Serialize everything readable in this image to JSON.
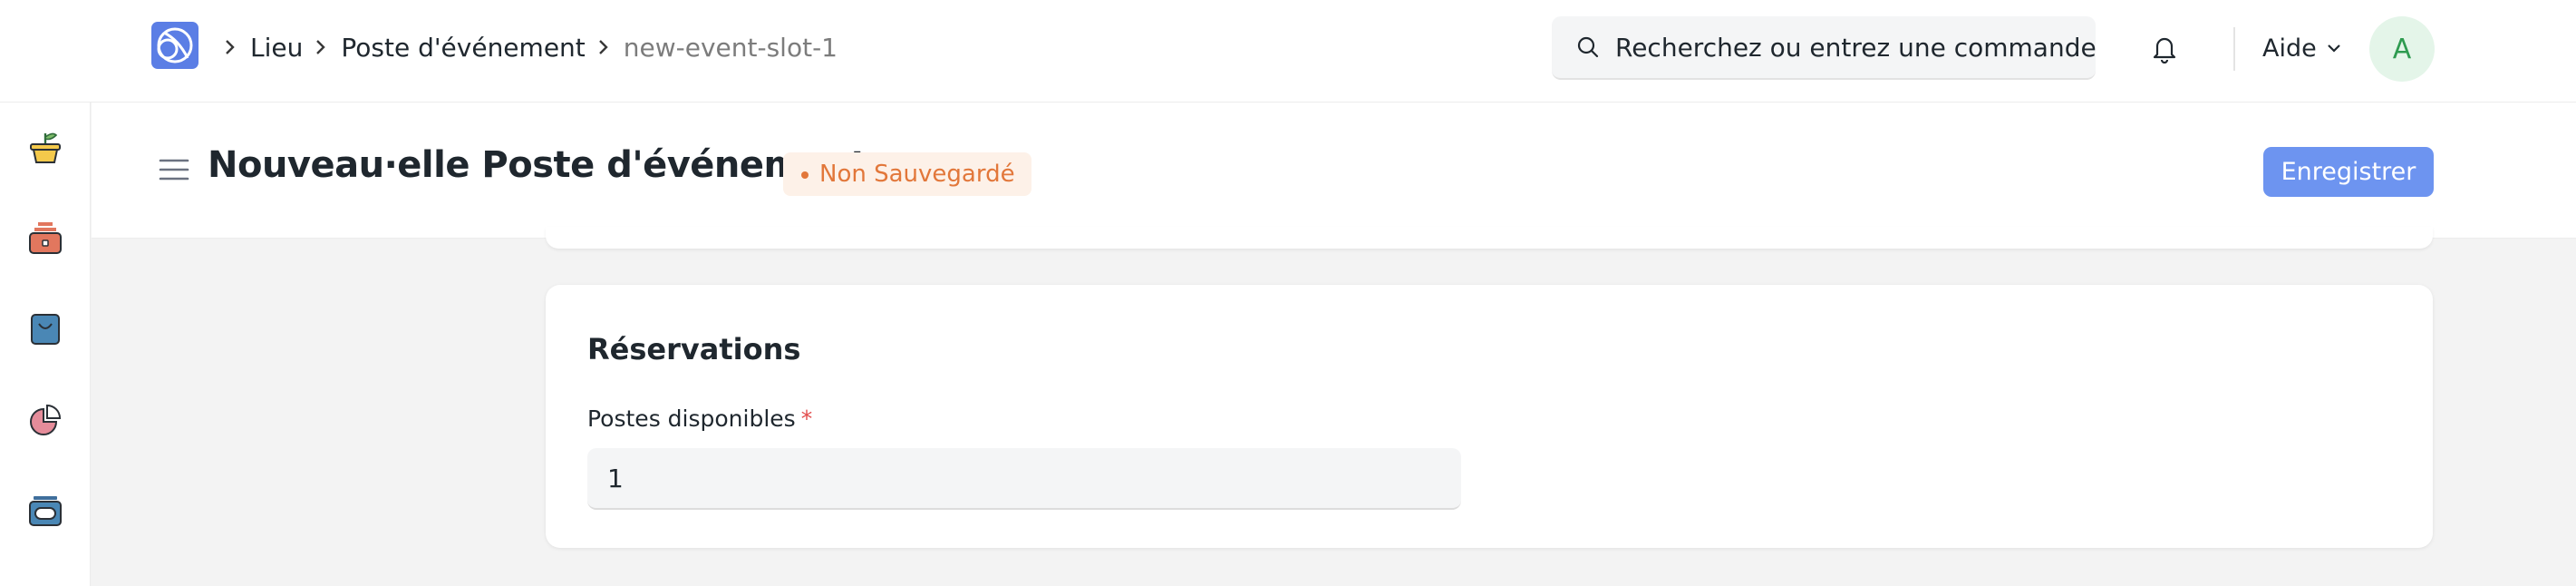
{
  "breadcrumb": {
    "items": [
      "Lieu",
      "Poste d'événement"
    ],
    "current": "new-event-slot-1"
  },
  "search": {
    "placeholder": "Recherchez ou entrez une commande"
  },
  "navbar": {
    "help_label": "Aide",
    "avatar_initial": "A"
  },
  "sidebar": {
    "icons": [
      "plant-pot-icon",
      "toolbox-icon",
      "shopping-bag-icon",
      "pie-chart-icon",
      "archive-box-icon"
    ]
  },
  "page": {
    "title": "Nouveau·elle Poste d'événement",
    "status_badge": "Non Sauvegardé",
    "save_label": "Enregistrer"
  },
  "section": {
    "title": "Réservations",
    "field_label": "Postes disponibles",
    "required_mark": "*",
    "field_value": "1"
  },
  "colors": {
    "accent": "#6d94f0",
    "badge_text": "#e2773a",
    "badge_bg": "#fdf1e8",
    "avatar_bg": "#e4f5e9",
    "avatar_text": "#2e9b50"
  }
}
